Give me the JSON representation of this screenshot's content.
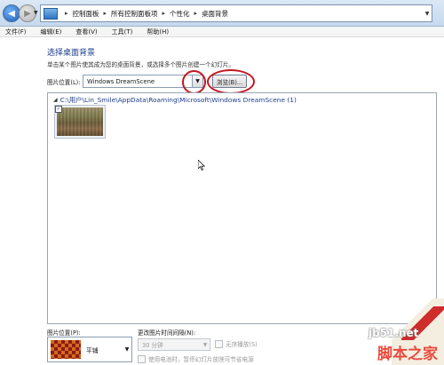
{
  "address_bar": {
    "breadcrumbs": [
      "控制面板",
      "所有控制面板项",
      "个性化",
      "桌面背景"
    ]
  },
  "menu": [
    "文件(F)",
    "编辑(E)",
    "查看(V)",
    "工具(T)",
    "帮助(H)"
  ],
  "page": {
    "title": "选择桌面背景",
    "description": "单击某个图片使其成为您的桌面背景，或选择多个图片创建一个幻灯片。"
  },
  "picture_location": {
    "label": "图片位置(L):",
    "value": "Windows DreamScene",
    "browse_label": "浏览(B)..."
  },
  "gallery": {
    "group_header": "C:\\用户\\Lin_Smile\\AppData\\Roaming\\Microsoft\\Windows DreamScene (1)",
    "items": [
      {
        "selected": true
      }
    ]
  },
  "bottom": {
    "position_label": "图片位置(P):",
    "position_value": "平铺",
    "interval_label": "更改图片时间间隔(N):",
    "interval_value": "30 分钟",
    "shuffle_label": "无序播放(S)",
    "battery_label": "使用电池时，暂停幻灯片放映可节省电源"
  },
  "watermark": {
    "site": "jb51.net",
    "brand": "脚本之家"
  },
  "colors": {
    "accent_title": "#1e3d8c",
    "annotation": "#c3151f"
  }
}
